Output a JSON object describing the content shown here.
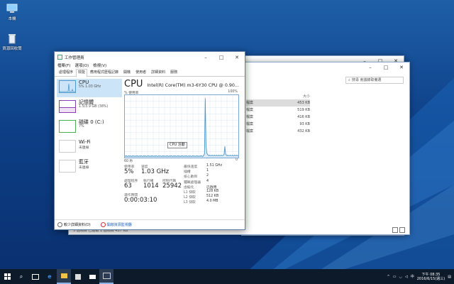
{
  "desktop": {
    "icons": [
      {
        "label": "本機",
        "icon": "computer-icon"
      },
      {
        "label": "資源回收筒",
        "icon": "recycle-bin-icon"
      }
    ]
  },
  "explorer": {
    "search_placeholder": "搜尋 會議錄取備選",
    "list_header": "大小",
    "rows": [
      {
        "name": "檔案",
        "size": "453 KB",
        "selected": true
      },
      {
        "name": "檔案",
        "size": "519 KB",
        "selected": false
      },
      {
        "name": "檔案",
        "size": "416 KB",
        "selected": false
      },
      {
        "name": "檔案",
        "size": "93 KB",
        "selected": false
      },
      {
        "name": "檔案",
        "size": "432 KB",
        "selected": false
      }
    ],
    "status": "5 個項目  已選取 1 個項目  457 KB"
  },
  "task_manager": {
    "title": "工作管理員",
    "menu": [
      "檔案(F)",
      "選項(O)",
      "檢視(V)"
    ],
    "tabs": [
      "處理程序",
      "效能",
      "應用程式歷程記錄",
      "開機",
      "使用者",
      "詳細資料",
      "服務"
    ],
    "active_tab": "效能",
    "resources": [
      {
        "name": "CPU",
        "sub": "5% 1.03 GHz",
        "selected": true
      },
      {
        "name": "記憶體",
        "sub": "1.5/3.9 GB (38%)",
        "selected": false
      },
      {
        "name": "磁碟 0 (C:)",
        "sub": "7%",
        "selected": false
      },
      {
        "name": "Wi-Fi",
        "sub": "未連線",
        "selected": false
      },
      {
        "name": "藍牙",
        "sub": "未連線",
        "selected": false
      }
    ],
    "cpu": {
      "title": "CPU",
      "model": "Intel(R) Core(TM) m3-6Y30 CPU @ 0.90...",
      "axis_label": "% 使用率",
      "axis_max": "100%",
      "axis_time": "60 秒",
      "axis_min": "0",
      "tooltip": "CPU 活動",
      "usage_series": [
        3,
        2,
        3,
        2,
        2,
        3,
        2,
        3,
        2,
        2,
        3,
        2,
        3,
        2,
        2,
        3,
        2,
        3,
        2,
        2,
        3,
        2,
        3,
        2,
        2,
        3,
        2,
        3,
        2,
        2,
        3,
        2,
        3,
        2,
        2,
        3,
        2,
        3,
        2,
        2,
        3,
        2,
        3,
        2,
        2,
        3,
        2,
        3,
        2,
        2,
        3,
        2,
        3,
        2,
        2,
        3,
        2,
        3,
        2,
        2,
        3,
        2,
        3,
        2,
        2,
        3,
        2,
        3,
        2,
        2,
        3,
        2,
        3,
        2,
        2,
        3,
        2,
        3,
        2,
        2,
        3,
        2,
        3,
        2,
        2,
        3,
        2,
        3,
        2,
        2,
        3,
        2,
        3,
        2,
        2,
        3,
        2,
        3,
        2,
        2,
        3,
        2,
        3,
        2,
        2,
        4,
        6,
        95,
        20,
        8,
        5,
        4,
        3,
        4,
        3,
        3,
        4,
        3,
        3,
        4,
        3,
        3,
        4,
        3,
        3,
        4,
        3,
        3,
        4,
        3,
        3,
        4,
        5,
        18,
        6,
        4,
        3,
        4,
        3,
        3,
        4,
        3,
        3,
        4,
        3,
        3,
        4,
        3,
        3,
        4,
        3,
        3
      ],
      "stats": {
        "usage_label": "使用率",
        "usage": "5%",
        "speed_label": "速度",
        "speed": "1.03 GHz",
        "processes_label": "處理程序",
        "processes": "63",
        "threads_label": "執行緒",
        "threads": "1014",
        "handles_label": "控制代碼",
        "handles": "25942",
        "uptime_label": "運作時間",
        "uptime": "0:00:03:10"
      },
      "specs": [
        {
          "k": "最快速度",
          "v": "1.51 GHz"
        },
        {
          "k": "插槽",
          "v": "1"
        },
        {
          "k": "核心數目",
          "v": "2"
        },
        {
          "k": "邏輯處理器",
          "v": "4"
        },
        {
          "k": "虛擬化",
          "v": "已啟用"
        },
        {
          "k": "L1 快取",
          "v": "128 KB"
        },
        {
          "k": "L2 快取",
          "v": "512 KB"
        },
        {
          "k": "L3 快取",
          "v": "4.0 MB"
        }
      ]
    },
    "footer": {
      "fewer_details": "較少詳細資料(D)",
      "open_monitor": "開啟資源監視器"
    }
  },
  "taskbar": {
    "clock_time": "下午 08:35",
    "clock_date": "2016/6/15(週三)"
  },
  "colors": {
    "desktop": "#0d3f86",
    "cpu_graph": "#4f98c9",
    "selection": "#cce4f7"
  }
}
